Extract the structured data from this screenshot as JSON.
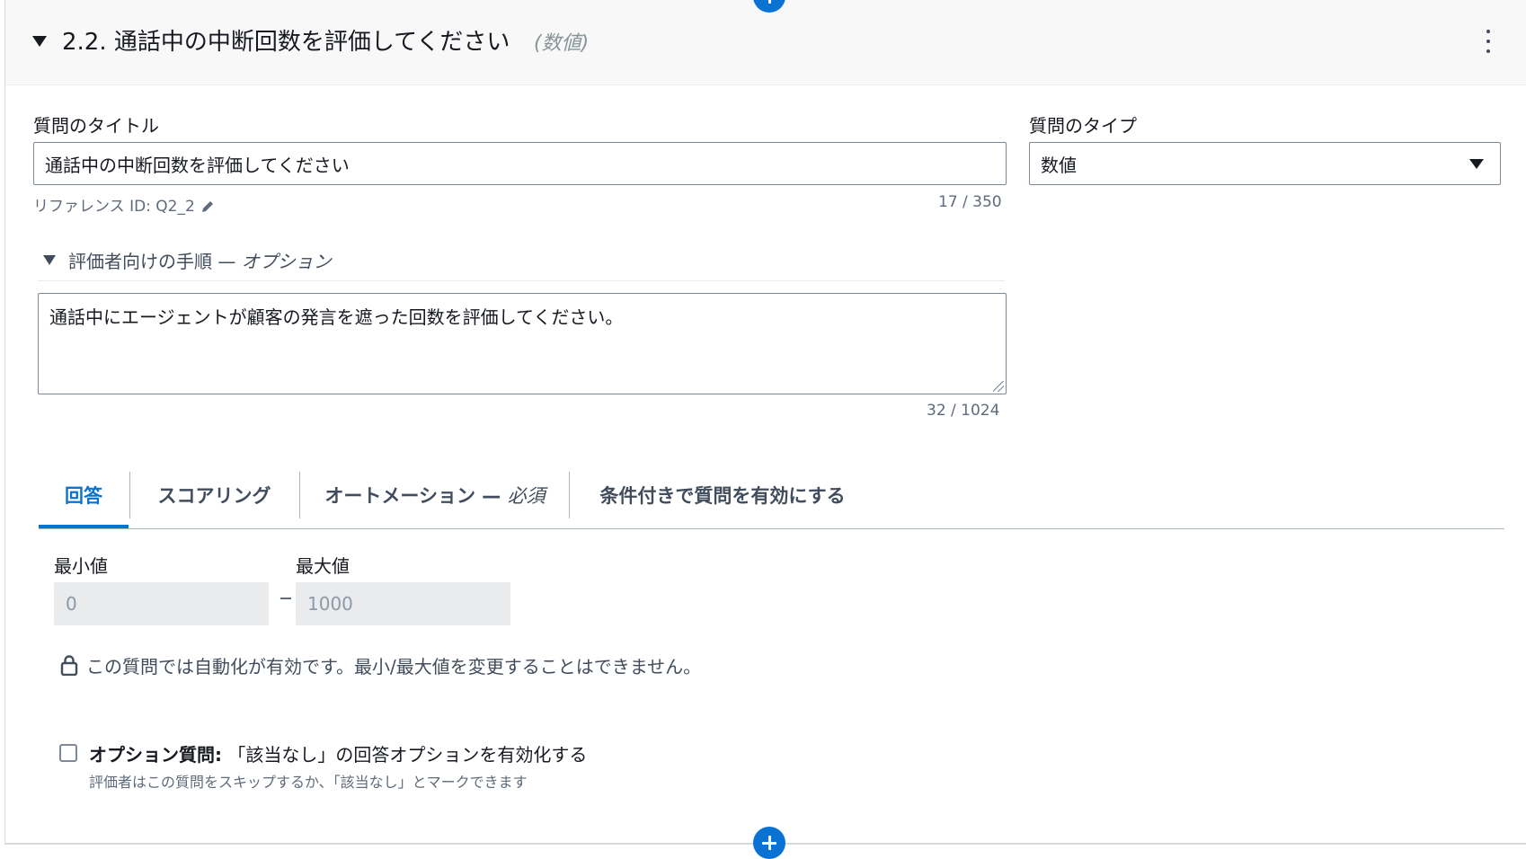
{
  "section": {
    "number": "2.2.",
    "title": "通話中の中断回数を評価してください",
    "type_hint": "(数値)"
  },
  "question_title": {
    "label": "質問のタイトル",
    "value": "通話中の中断回数を評価してください",
    "reference_label": "リファレンス ID: Q2_2",
    "char_count": "17 / 350"
  },
  "question_type": {
    "label": "質問のタイプ",
    "value": "数値"
  },
  "instructions": {
    "label": "評価者向けの手順 —",
    "optional": "オプション",
    "value": "通話中にエージェントが顧客の発言を遮った回数を評価してください。",
    "char_count": "32 / 1024"
  },
  "tabs": {
    "answer": "回答",
    "scoring": "スコアリング",
    "automation": "オートメーション —",
    "automation_required": "必須",
    "conditional": "条件付きで質問を有効にする",
    "active": "回答"
  },
  "range": {
    "min_label": "最小値",
    "min_value": "0",
    "max_label": "最大値",
    "max_value": "1000",
    "lock_message": "この質問では自動化が有効です。最小/最大値を変更することはできません。"
  },
  "optional_question": {
    "label_bold": "オプション質問:",
    "label": "「該当なし」の回答オプションを有効化する",
    "description": "評価者はこの質問をスキップするか、「該当なし」とマークできます",
    "checked": false
  },
  "colors": {
    "accent": "#0972d3",
    "header_bg": "#f8f8f8",
    "disabled_input_bg": "#e9ebed"
  }
}
